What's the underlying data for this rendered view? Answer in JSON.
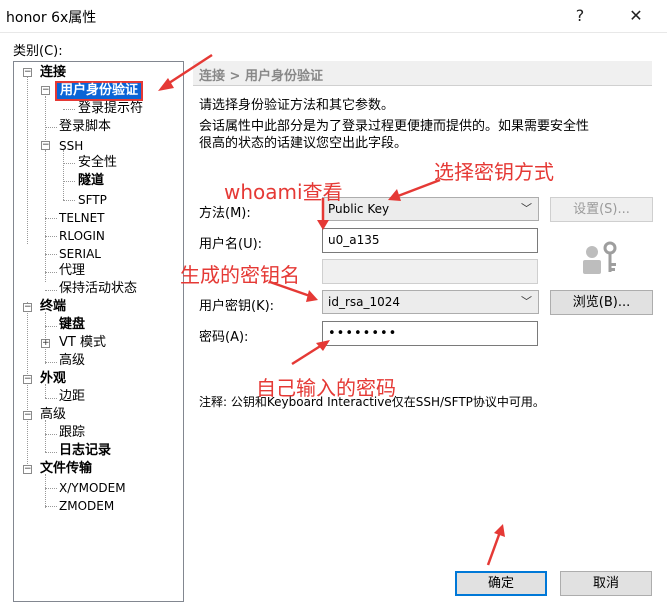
{
  "window": {
    "title": "honor 6x属性",
    "help": "?",
    "close": "✕"
  },
  "category_label": "类别(C):",
  "tree": {
    "connection": "连接",
    "user_auth": "用户身份验证",
    "login_prompt": "登录提示符",
    "login_script": "登录脚本",
    "ssh": "SSH",
    "security": "安全性",
    "tunnel": "隧道",
    "sftp": "SFTP",
    "telnet": "TELNET",
    "rlogin": "RLOGIN",
    "serial": "SERIAL",
    "proxy": "代理",
    "keepalive": "保持活动状态",
    "terminal": "终端",
    "keyboard": "键盘",
    "vt_mode": "VT 模式",
    "advanced": "高级",
    "appearance": "外观",
    "margin": "边距",
    "advanced2": "高级",
    "trace": "跟踪",
    "log": "日志记录",
    "file_transfer": "文件传输",
    "xymodem": "X/YMODEM",
    "zmodem": "ZMODEM"
  },
  "panel": {
    "breadcrumb": "连接 > 用户身份验证",
    "desc1": "请选择身份验证方法和其它参数。",
    "desc2": "会话属性中此部分是为了登录过程更便捷而提供的。如果需要安全性",
    "desc3": "很高的状态的话建议您空出此字段。",
    "method_label": "方法(M):",
    "method_value": "Public Key",
    "settings_button": "设置(S)...",
    "username_label": "用户名(U):",
    "username_value": "u0_a135",
    "passphrase_value": "",
    "userkey_label": "用户密钥(K):",
    "userkey_value": "id_rsa_1024",
    "browse_button": "浏览(B)...",
    "password_label": "密码(A):",
    "password_value": "••••••••",
    "note": "注释: 公钥和Keyboard Interactive仅在SSH/SFTP协议中可用。"
  },
  "footer": {
    "ok": "确定",
    "cancel": "取消"
  },
  "annotations": {
    "select_key": "选择密钥方式",
    "whoami": "whoami查看",
    "generated_key": "生成的密钥名",
    "own_password": "自己输入的密码"
  },
  "colors": {
    "accent": "#0078d7",
    "selection": "#0a64d6",
    "annotation": "#e53935"
  }
}
